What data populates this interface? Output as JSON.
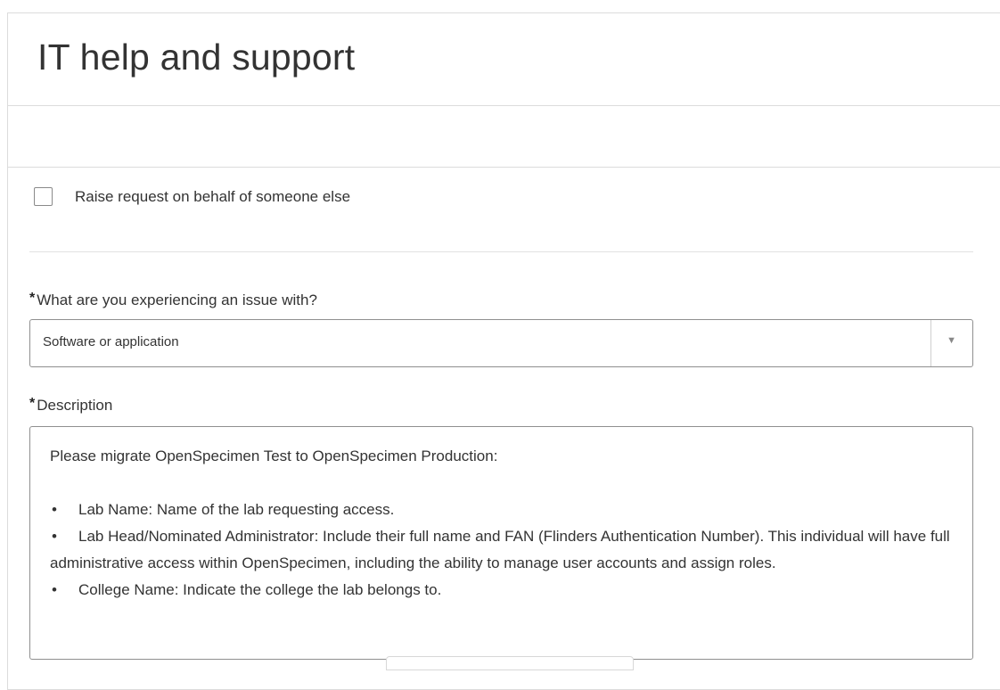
{
  "page": {
    "title": "IT help and support"
  },
  "form": {
    "on_behalf_checkbox": {
      "label": "Raise request on behalf of someone else",
      "checked": false
    },
    "issue_field": {
      "required_marker": "*",
      "label": "What are you experiencing an issue with?",
      "value": "Software or application",
      "arrow_glyph": "▼"
    },
    "description_field": {
      "required_marker": "*",
      "label": "Description",
      "intro": "Please migrate OpenSpecimen Test to OpenSpecimen Production:",
      "bullet_glyph": "•",
      "bullets": [
        "Lab Name: Name of the lab requesting access.",
        "Lab Head/Nominated Administrator: Include their full name and FAN (Flinders Authentication Number). This individual will have full administrative access within OpenSpecimen, including the ability to manage user accounts and assign roles.",
        "College Name: Indicate the college the lab belongs to."
      ]
    }
  }
}
